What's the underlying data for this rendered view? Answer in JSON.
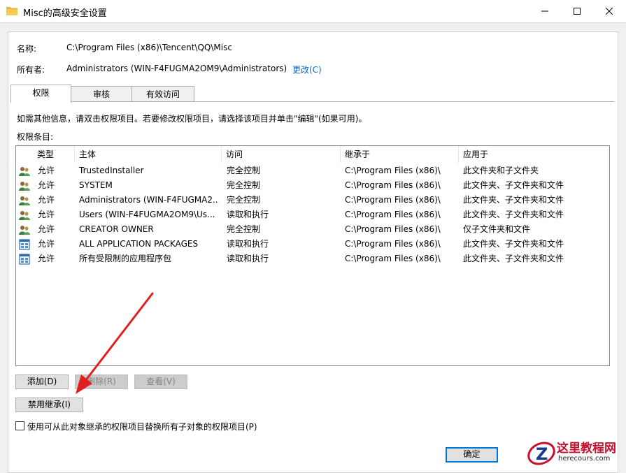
{
  "window": {
    "title": "Misc的高级安全设置",
    "icons": [
      "folder-icon",
      "minimize-icon",
      "maximize-icon",
      "close-icon"
    ]
  },
  "info": {
    "name_label": "名称:",
    "name_value": "C:\\Program Files (x86)\\Tencent\\QQ\\Misc",
    "owner_label": "所有者:",
    "owner_value": "Administrators (WIN-F4FUGMA2OM9\\Administrators)",
    "change_link": "更改(C)"
  },
  "tabs": [
    {
      "label": "权限",
      "active": true
    },
    {
      "label": "审核",
      "active": false
    },
    {
      "label": "有效访问",
      "active": false
    }
  ],
  "hint": "如需其他信息，请双击权限项目。若要修改权限项目，请选择该项目并单击\"编辑\"(如果可用)。",
  "entries_label": "权限条目:",
  "table": {
    "columns": [
      "类型",
      "主体",
      "访问",
      "继承于",
      "应用于"
    ],
    "rows": [
      {
        "icon": "user-group-icon",
        "type": "允许",
        "principal": "TrustedInstaller",
        "access": "完全控制",
        "inherited": "C:\\Program Files (x86)\\",
        "applies": "此文件夹和子文件夹"
      },
      {
        "icon": "user-group-icon",
        "type": "允许",
        "principal": "SYSTEM",
        "access": "完全控制",
        "inherited": "C:\\Program Files (x86)\\",
        "applies": "此文件夹、子文件夹和文件"
      },
      {
        "icon": "user-group-icon",
        "type": "允许",
        "principal": "Administrators (WIN-F4FUGMA2...",
        "access": "完全控制",
        "inherited": "C:\\Program Files (x86)\\",
        "applies": "此文件夹、子文件夹和文件"
      },
      {
        "icon": "user-group-icon",
        "type": "允许",
        "principal": "Users (WIN-F4FUGMA2OM9\\Us...",
        "access": "读取和执行",
        "inherited": "C:\\Program Files (x86)\\",
        "applies": "此文件夹、子文件夹和文件"
      },
      {
        "icon": "user-group-icon",
        "type": "允许",
        "principal": "CREATOR OWNER",
        "access": "完全控制",
        "inherited": "C:\\Program Files (x86)\\",
        "applies": "仅子文件夹和文件"
      },
      {
        "icon": "app-package-icon",
        "type": "允许",
        "principal": "ALL APPLICATION PACKAGES",
        "access": "读取和执行",
        "inherited": "C:\\Program Files (x86)\\",
        "applies": "此文件夹、子文件夹和文件"
      },
      {
        "icon": "app-package-icon",
        "type": "允许",
        "principal": "所有受限制的应用程序包",
        "access": "读取和执行",
        "inherited": "C:\\Program Files (x86)\\",
        "applies": "此文件夹、子文件夹和文件"
      }
    ]
  },
  "buttons": {
    "add": "添加(D)",
    "remove": "删除(R)",
    "view": "查看(V)",
    "disable_inheritance": "禁用继承(I)",
    "ok": "确定"
  },
  "checkbox_label": "使用可从此对象继承的权限项目替换所有子对象的权限项目(P)",
  "watermark": {
    "title": "这里教程网",
    "url": "herecours.com",
    "logo_letter": "Z"
  },
  "colors": {
    "accent": "#0078d7",
    "link": "#0066cc",
    "arrow": "#e02020",
    "watermark_red": "#c8102e"
  }
}
